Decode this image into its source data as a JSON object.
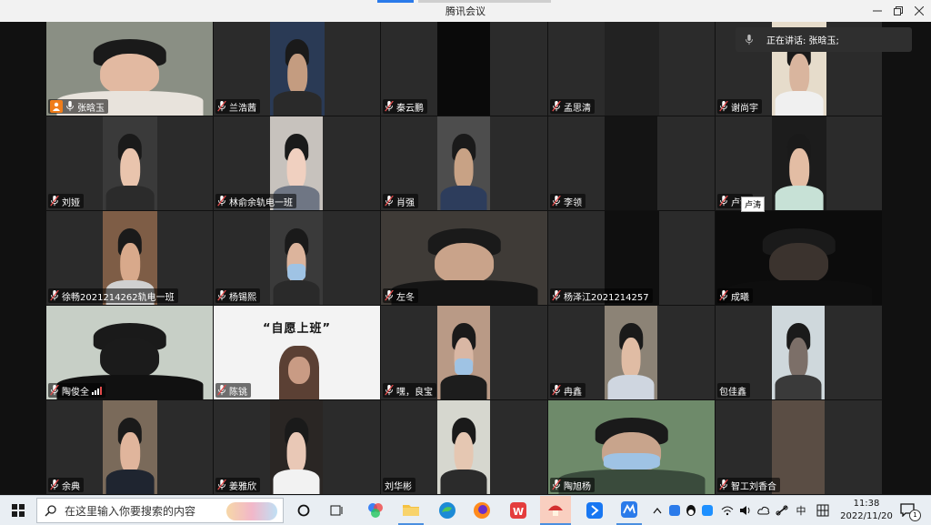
{
  "window": {
    "title": "腾讯会议"
  },
  "speaking": {
    "text": "正在讲话: 张晗玉;"
  },
  "tooltip": {
    "text": "卢涛"
  },
  "participants": [
    {
      "name": "张晗玉",
      "host": true
    },
    {
      "name": "兰浩茜"
    },
    {
      "name": "秦云鹏"
    },
    {
      "name": "孟思清"
    },
    {
      "name": "谢尚宇"
    },
    {
      "name": "刘娅"
    },
    {
      "name": "林俞余轨电一班"
    },
    {
      "name": "肖强"
    },
    {
      "name": "李领"
    },
    {
      "name": "卢涛"
    },
    {
      "name": "徐畅2021214262轨电一班"
    },
    {
      "name": "杨锡熙"
    },
    {
      "name": "左冬"
    },
    {
      "name": "杨泽江2021214257"
    },
    {
      "name": "成曦"
    },
    {
      "name": "陶俊全",
      "signal": true
    },
    {
      "name": "陈铫"
    },
    {
      "name": "嘿，良宝"
    },
    {
      "name": "冉鑫"
    },
    {
      "name": "包佳鑫",
      "no_mic": true
    },
    {
      "name": "余典"
    },
    {
      "name": "姜雅欣"
    },
    {
      "name": "刘华彬",
      "no_mic": true
    },
    {
      "name": "陶旭杨"
    },
    {
      "name": "智工刘香合"
    }
  ],
  "meme": {
    "text": "“自愿上班”"
  },
  "taskbar": {
    "search_placeholder": "在这里输入你要搜索的内容",
    "ime_label": "中",
    "time": "11:38",
    "date": "2022/11/20",
    "notification_count": "1"
  }
}
